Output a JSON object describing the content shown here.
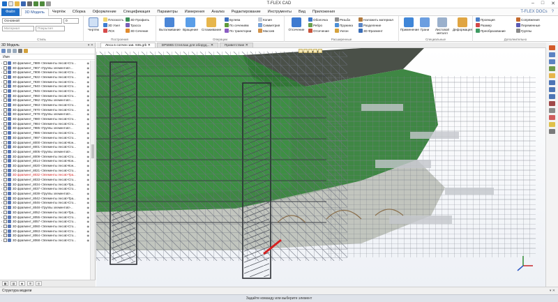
{
  "app": {
    "title": "T-FLEX CAD"
  },
  "window_controls": [
    "–",
    "□",
    "✕"
  ],
  "ribbon_tabs": [
    {
      "label": "Файл"
    },
    {
      "label": "3D Модель"
    },
    {
      "label": "Чертёж"
    },
    {
      "label": "Сборка"
    },
    {
      "label": "Оформление"
    },
    {
      "label": "Спецификация"
    },
    {
      "label": "Параметры"
    },
    {
      "label": "Измерения"
    },
    {
      "label": "Анализ"
    },
    {
      "label": "Редактирование"
    },
    {
      "label": "Инструменты"
    },
    {
      "label": "Вид"
    },
    {
      "label": "Приложения"
    }
  ],
  "docs_button": "T-FLEX DOCs",
  "ribbon": {
    "style_select": "Основной",
    "style_value": "0",
    "material_placeholder": "Материал",
    "cover_placeholder": "Покрытия",
    "group_styles": "Стиль",
    "sketch": "Чертёж",
    "plane": "Плоскость",
    "node3d": "3D Узел",
    "lsk": "ЛСК",
    "profile3d": "3D Профиль",
    "path": "Трасса",
    "section3d": "3D Сечение",
    "group_build": "Построения",
    "extrude": "Выталкивание",
    "revolve": "Вращение",
    "loft": "Сглаживание",
    "boolean": "Булева",
    "by_sections": "По сечениям",
    "by_trajectory": "По траектории",
    "copy": "Копия",
    "symmetry": "Симметрия",
    "array": "Массив",
    "group_operations": "Операции",
    "offset": "Отсечение",
    "shell": "Оболочка",
    "edge": "Ребро",
    "cut": "Отсечение",
    "thread": "Резьба",
    "spring": "Пружина",
    "angle": "Уклон",
    "apply_material": "Наложить материал",
    "split": "Разделение",
    "fragment3d": "3D Фрагмент",
    "group_extended": "Расширенные",
    "apply": "Применение",
    "face": "Грани",
    "sheet_metal": "Листовой металл",
    "deform": "Деформация",
    "group_special": "Специальные",
    "projection": "Проекция",
    "size": "Размер",
    "transform": "Преобразование",
    "mate": "Сопряжения",
    "variables": "Переменные",
    "groups": "Группы",
    "group_extra": "Дополнительно"
  },
  "panel": {
    "title": "3D Модель",
    "column": "Имя",
    "rows": [
      {
        "text": "3D фрагмент_7889 <Элементы лесов>Сто..."
      },
      {
        "text": "3D фрагмент_7907 <Группы элементов>..."
      },
      {
        "text": "3D фрагмент_7908 <Элементы лесов>Сто..."
      },
      {
        "text": "3D фрагмент_7922 <Элементы лесов>Сто..."
      },
      {
        "text": "3D фрагмент_7930 <Элементы лесов>Сто..."
      },
      {
        "text": "3D фрагмент_7940 <Элементы лесов>Сто..."
      },
      {
        "text": "3D фрагмент_7946 <Элементы лесов>Сто..."
      },
      {
        "text": "3D фрагмент_7950 <Элементы лесов>Сто..."
      },
      {
        "text": "3D фрагмент_7962 <Группы элементов>..."
      },
      {
        "text": "3D фрагмент_7963 <Элементы лесов>Сто..."
      },
      {
        "text": "3D фрагмент_7970 <Элементы лесов>Сто..."
      },
      {
        "text": "3D фрагмент_7978 <Группы элементов>..."
      },
      {
        "text": "3D фрагмент_7980 <Элементы лесов>Сто..."
      },
      {
        "text": "3D фрагмент_7984 <Элементы лесов>Сто..."
      },
      {
        "text": "3D фрагмент_7985 <Группы элементов>..."
      },
      {
        "text": "3D фрагмент_7986 <Элементы лесов>Сто..."
      },
      {
        "text": "3D фрагмент_7997 <Элементы лесов>Сто..."
      },
      {
        "text": "3D фрагмент_8000 <Элементы лесов>Кон..."
      },
      {
        "text": "3D фрагмент_8001 <Элементы лесов>Сто..."
      },
      {
        "text": "3D фрагмент_8005 <Группы элементов>..."
      },
      {
        "text": "3D фрагмент_8009 <Элементы лесов>Сто..."
      },
      {
        "text": "3D фрагмент_8014 <Элементы лесов>Кон..."
      },
      {
        "text": "3D фрагмент_8020 <Элементы лесов>Кон..."
      },
      {
        "text": "3D фрагмент_8021 <Элементы лесов>Сто..."
      },
      {
        "text": "3D фрагмент_8032 <Элементы лесов>Тра...",
        "red": true
      },
      {
        "text": "3D фрагмент_8033 <Элементы лесов>Сто..."
      },
      {
        "text": "3D фрагмент_8034 <Элементы лесов>Тра..."
      },
      {
        "text": "3D фрагмент_8037 <Элементы лесов>Сто..."
      },
      {
        "text": "3D фрагмент_8039 <Группы элементов>..."
      },
      {
        "text": "3D фрагмент_8042 <Элементы лесов>Тра..."
      },
      {
        "text": "3D фрагмент_8046 <Элементы лесов>Сто..."
      },
      {
        "text": "3D фрагмент_8048 <Группы элементов>..."
      },
      {
        "text": "3D фрагмент_8052 <Элементы лесов>Тра..."
      },
      {
        "text": "3D фрагмент_8055 <Элементы лесов>Сто..."
      },
      {
        "text": "3D фрагмент_8057 <Элементы лесов>Сто..."
      },
      {
        "text": "3D фрагмент_8060 <Элементы лесов>Сто..."
      },
      {
        "text": "3D фрагмент_8063 <Элементы лесов>Сто..."
      },
      {
        "text": "3D фрагмент_8064 <Элементы лесов>Сто..."
      },
      {
        "text": "3D фрагмент_8068 <Элементы лесов>Сто..."
      }
    ]
  },
  "doc_tabs": [
    {
      "label": "Леса в сопчен зав. 935.grb",
      "active": true
    },
    {
      "label": "DP5965 Стеллаж для оборуд..."
    },
    {
      "label": "Приветствие"
    }
  ],
  "structure_bar": "Структура модели",
  "status": "Задайте команду или выберите элемент",
  "colors": {
    "accent": "#1f6fc8",
    "hull_green": "#2e7d2e",
    "scaffold": "#7a7f8a"
  }
}
